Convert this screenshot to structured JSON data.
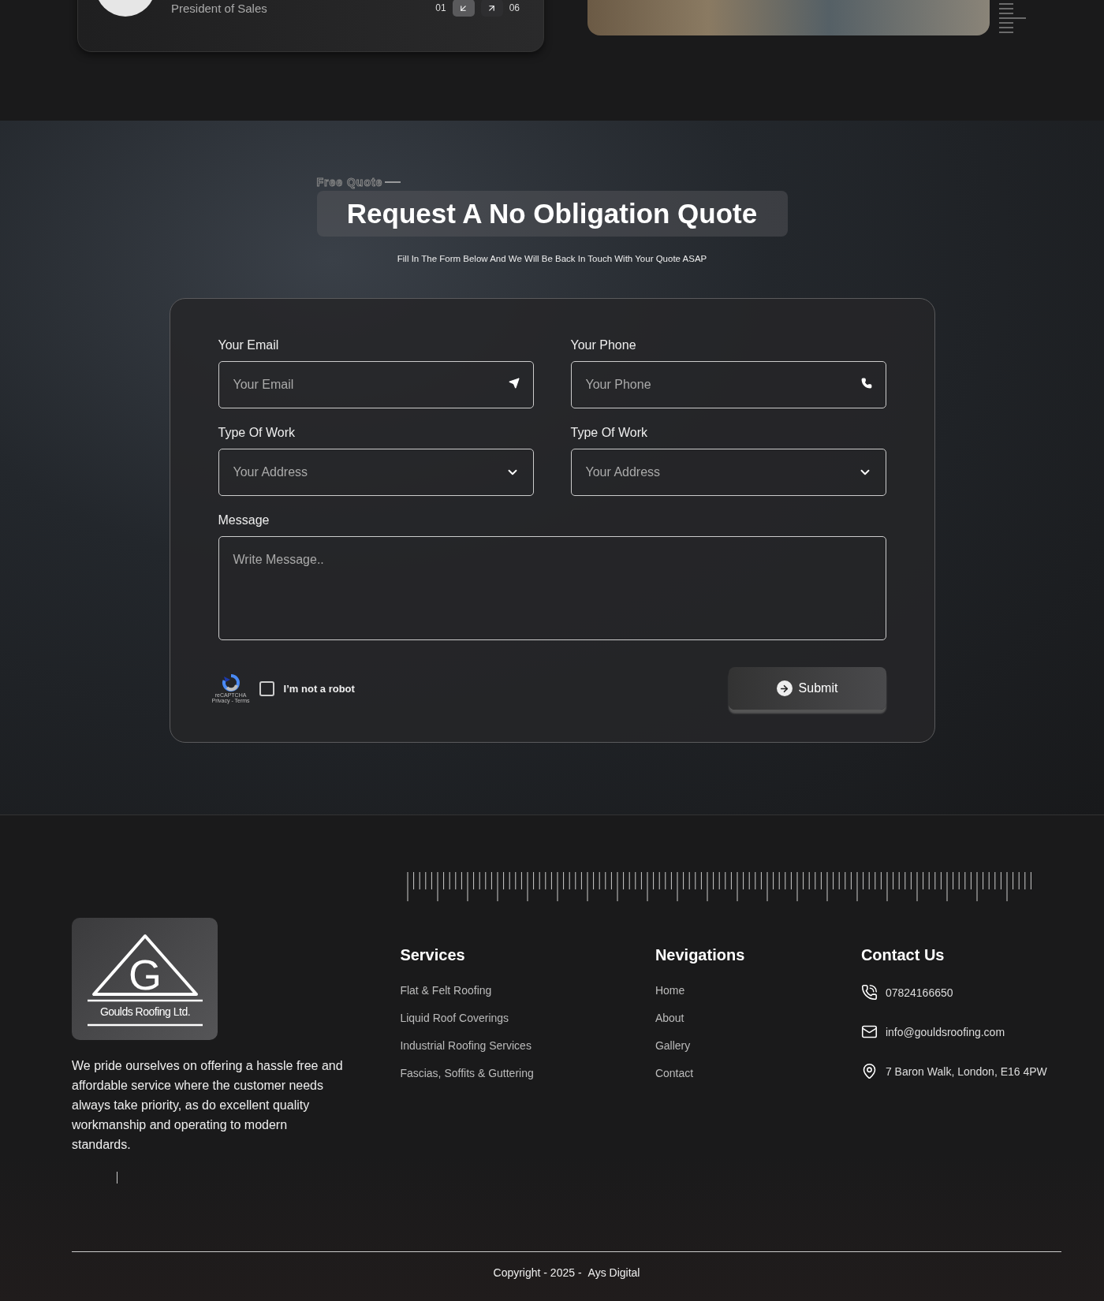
{
  "testimonial": {
    "role": "President of Sales",
    "counter_start": "01",
    "counter_end": "06",
    "nav_buttons": [
      {
        "kind": "prev",
        "selected": true
      },
      {
        "kind": "next",
        "selected": false
      }
    ]
  },
  "quote": {
    "eyebrow": "Free Quote",
    "title": "Request A No Obligation Quote",
    "subtitle": "Fill In The Form Below And We Will Be Back In Touch With Your Quote ASAP",
    "fields": [
      {
        "kind": "email",
        "label": "Your Email",
        "placeholder": "Your Email"
      },
      {
        "kind": "phone",
        "label": "Your Phone",
        "placeholder": "Your Phone"
      },
      {
        "kind": "select",
        "label": "Type Of Work",
        "placeholder": "Your Address"
      },
      {
        "kind": "select",
        "label": "Type Of Work",
        "placeholder": "Your Address"
      },
      {
        "kind": "textarea",
        "label": "Message",
        "placeholder": "Write Message.."
      }
    ],
    "captcha": {
      "brand": "reCAPTCHA",
      "links": "Privacy - Terms",
      "label": "I’m not a robot",
      "checked": false
    },
    "submit": "Submit"
  },
  "footer": {
    "logo_mark": "G",
    "logo_text": "Goulds Roofing Ltd.",
    "about": "We pride ourselves on offering a hassle free and affordable service where the customer needs always take priority, as do excellent quality workmanship and operating to modern standards.",
    "services": {
      "title": "Services",
      "items": [
        "Flat & Felt Roofing",
        "Liquid Roof Coverings",
        "Industrial Roofing Services",
        "Fascias, Soffits & Guttering"
      ]
    },
    "navigation": {
      "title": "Nevigations",
      "items": [
        "Home",
        "About",
        "Gallery",
        "Contact"
      ]
    },
    "contact": {
      "title": "Contact Us",
      "items": [
        {
          "kind": "phone",
          "text": "07824166650"
        },
        {
          "kind": "email",
          "text": "info@gouldsroofing.com"
        },
        {
          "kind": "address",
          "text": "7 Baron Walk, London, E16 4PW"
        }
      ]
    },
    "copyright": "Copyright - 2025 -",
    "credit": "Ays Digital"
  }
}
